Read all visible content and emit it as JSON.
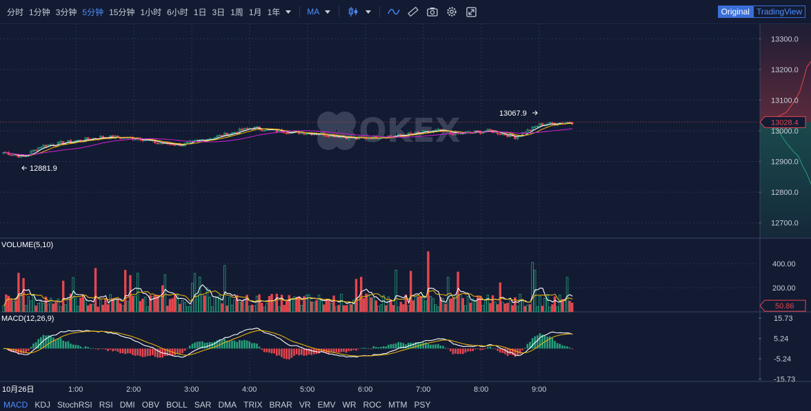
{
  "toolbar": {
    "intervals": [
      {
        "label": "分时",
        "active": false
      },
      {
        "label": "1分钟",
        "active": false
      },
      {
        "label": "3分钟",
        "active": false
      },
      {
        "label": "5分钟",
        "active": true
      },
      {
        "label": "15分钟",
        "active": false
      },
      {
        "label": "1小时",
        "active": false
      },
      {
        "label": "6小时",
        "active": false
      },
      {
        "label": "1日",
        "active": false
      },
      {
        "label": "3日",
        "active": false
      },
      {
        "label": "1周",
        "active": false
      },
      {
        "label": "1月",
        "active": false
      },
      {
        "label": "1年",
        "active": false
      }
    ],
    "indicator_label": "MA",
    "icons": [
      "candle-type-icon",
      "line-tool-icon",
      "ruler-icon",
      "camera-icon",
      "settings-icon",
      "fullscreen-icon"
    ],
    "view_original": "Original",
    "view_tradingview": "TradingView"
  },
  "chart_data": {
    "type": "candlestick",
    "watermark": "OKEX",
    "price_axis": {
      "ticks": [
        "13300.0",
        "13200.0",
        "13100.0",
        "13000.0",
        "12900.0",
        "12800.0",
        "12700.0"
      ],
      "range": [
        12650,
        13350
      ]
    },
    "current_price": "13028.4",
    "high_label": "13067.9",
    "low_label": "12881.9",
    "high": 13067.9,
    "low": 12881.9,
    "time_axis": [
      "10月26日",
      "1:00",
      "2:00",
      "3:00",
      "4:00",
      "5:00",
      "6:00",
      "7:00",
      "8:00",
      "9:00"
    ],
    "volume": {
      "title": "VOLUME(5,10)",
      "ticks": [
        "400.00",
        "200.00"
      ],
      "current": "50.86",
      "range": [
        0,
        520
      ]
    },
    "macd": {
      "title": "MACD(12,26,9)",
      "ticks": [
        "15.73",
        "5.24",
        "-5.24",
        "-15.73"
      ],
      "range": [
        -17,
        19
      ]
    },
    "colors": {
      "up": "#26a17b",
      "down": "#e5474f",
      "ma_white": "#ffffff",
      "ma_yellow": "#e9b10c",
      "ma_purple": "#c321c9",
      "current_price": "#e5474f"
    }
  },
  "bottom_bar": {
    "indicators": [
      {
        "label": "MACD",
        "active": true
      },
      {
        "label": "KDJ",
        "active": false
      },
      {
        "label": "StochRSI",
        "active": false
      },
      {
        "label": "RSI",
        "active": false
      },
      {
        "label": "DMI",
        "active": false
      },
      {
        "label": "OBV",
        "active": false
      },
      {
        "label": "BOLL",
        "active": false
      },
      {
        "label": "SAR",
        "active": false
      },
      {
        "label": "DMA",
        "active": false
      },
      {
        "label": "TRIX",
        "active": false
      },
      {
        "label": "BRAR",
        "active": false
      },
      {
        "label": "VR",
        "active": false
      },
      {
        "label": "EMV",
        "active": false
      },
      {
        "label": "WR",
        "active": false
      },
      {
        "label": "ROC",
        "active": false
      },
      {
        "label": "MTM",
        "active": false
      },
      {
        "label": "PSY",
        "active": false
      }
    ]
  }
}
